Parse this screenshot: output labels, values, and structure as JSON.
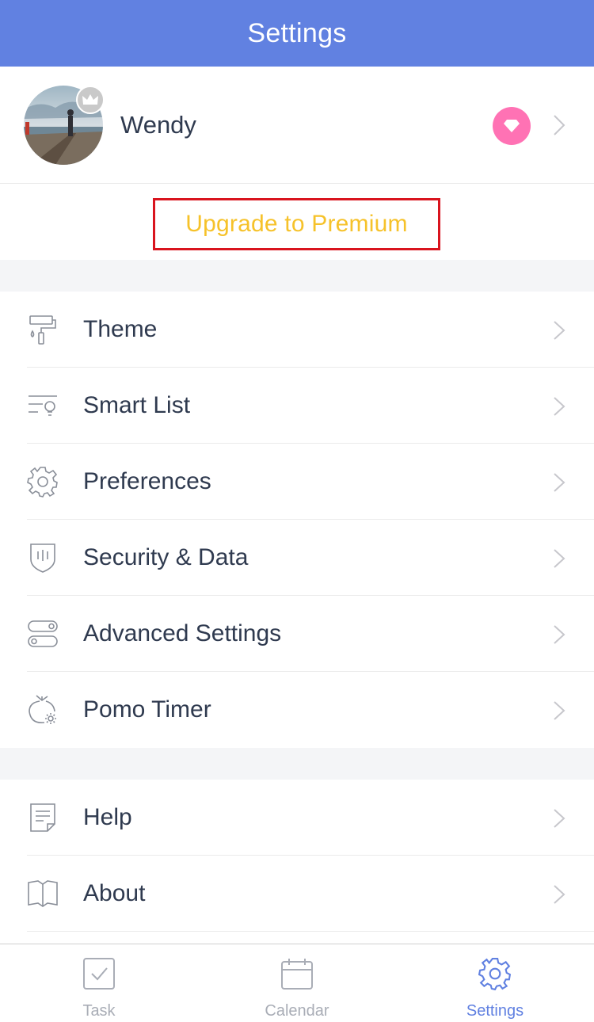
{
  "colors": {
    "accent": "#6181e1",
    "premium_text": "#f6c22a",
    "highlight_border": "#d9141e",
    "gem_badge": "#ff72b4"
  },
  "navbar": {
    "title": "Settings"
  },
  "profile": {
    "name": "Wendy",
    "avatar_icon": "avatar-photo",
    "crown_icon": "crown-icon",
    "gem_icon": "diamond-icon"
  },
  "upgrade": {
    "label": "Upgrade to Premium"
  },
  "group1": {
    "items": [
      {
        "label": "Theme",
        "icon": "paint-roller-icon"
      },
      {
        "label": "Smart List",
        "icon": "smart-list-icon"
      },
      {
        "label": "Preferences",
        "icon": "gear-icon"
      },
      {
        "label": "Security & Data",
        "icon": "shield-icon"
      },
      {
        "label": "Advanced Settings",
        "icon": "toggles-icon"
      },
      {
        "label": "Pomo Timer",
        "icon": "tomato-gear-icon"
      }
    ]
  },
  "group2": {
    "items": [
      {
        "label": "Help",
        "icon": "document-icon"
      },
      {
        "label": "About",
        "icon": "book-icon"
      }
    ]
  },
  "tabbar": {
    "tabs": [
      {
        "label": "Task",
        "icon": "checkbox-icon"
      },
      {
        "label": "Calendar",
        "icon": "calendar-icon"
      },
      {
        "label": "Settings",
        "icon": "gear-icon",
        "active": true
      }
    ]
  }
}
